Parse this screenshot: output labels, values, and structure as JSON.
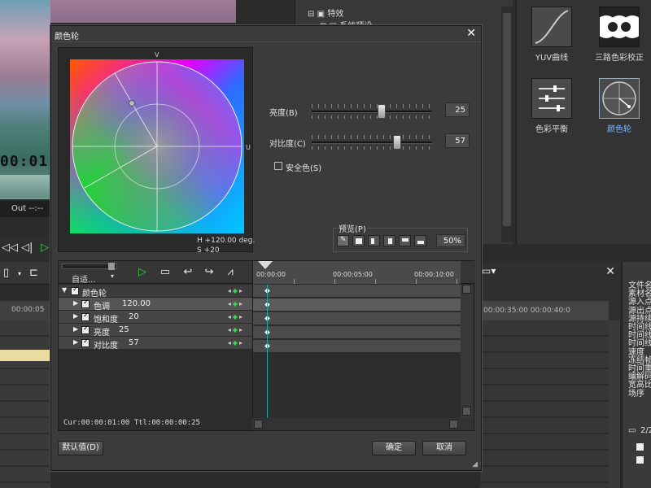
{
  "background": {
    "timecode": "00:01",
    "out_label": "Out --:--",
    "timeline_ruler_left": "00:00:05",
    "timeline_ruler_right": "00:00:35:00        00:00:40:0",
    "tree": {
      "root": "特效",
      "child": "系统预设"
    },
    "effects": [
      {
        "label": "YUV曲线",
        "icon": "curve-icon"
      },
      {
        "label": "三路色彩校正",
        "icon": "three-way-icon"
      },
      {
        "label": "色彩平衡",
        "icon": "sliders-icon"
      },
      {
        "label": "颜色轮",
        "icon": "color-wheel-icon",
        "selected": true
      }
    ],
    "properties": [
      "文件名",
      "素材名",
      "源入点",
      "源出点",
      "源持续",
      "时间线",
      "时间线",
      "时间线",
      "速度",
      "冻结帧",
      "时间重",
      "编解码",
      "宽高比",
      "场序"
    ],
    "counter": "2/2"
  },
  "dialog": {
    "title": "颜色轮",
    "wheel": {
      "axis_v": "V",
      "axis_u": "U",
      "hue_readout": "H +120.00 deg.",
      "sat_readout": "S +20"
    },
    "brightness": {
      "label": "亮度(B)",
      "value": "25",
      "level": 0.58
    },
    "contrast": {
      "label": "对比度(C)",
      "value": "57",
      "level": 0.71
    },
    "safe_color": {
      "label": "安全色(S)",
      "checked": false
    },
    "preview": {
      "label": "预览(P)",
      "zoom": "50%"
    },
    "keyframe": {
      "fit": "自适...",
      "ruler_labels": [
        "00:00:00",
        "00:00:05:00",
        "00:00:10:00"
      ],
      "rows": [
        {
          "name": "颜色轮",
          "value": ""
        },
        {
          "name": "色调",
          "value": "120.00"
        },
        {
          "name": "饱和度",
          "value": "20"
        },
        {
          "name": "亮度",
          "value": "25"
        },
        {
          "name": "对比度",
          "value": "57"
        }
      ],
      "cur": "Cur:00:00:01:00",
      "ttl": "Ttl:00:00:00:25"
    },
    "buttons": {
      "default": "默认值(D)",
      "ok": "确定",
      "cancel": "取消"
    }
  },
  "colors": {
    "accent_green": "#3ed14a",
    "playhead_line": "#2aa3b0",
    "selected_text": "#7fb8ff"
  }
}
